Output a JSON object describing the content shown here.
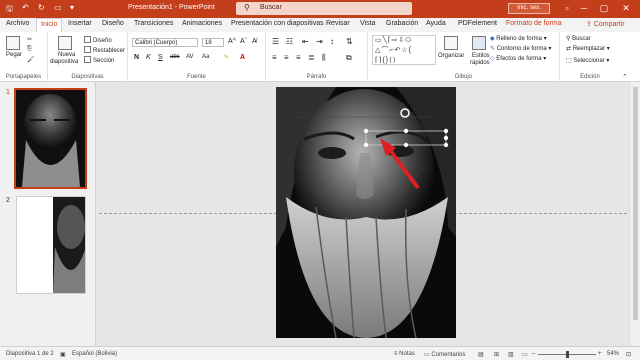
{
  "titlebar": {
    "doc_title": "Presentación1 - PowerPoint",
    "search_placeholder": "Buscar",
    "signin_label": "Inic. ses.",
    "window_buttons": [
      "─",
      "▢",
      "✕"
    ]
  },
  "tabs": [
    "Archivo",
    "Inicio",
    "Insertar",
    "Diseño",
    "Transiciones",
    "Animaciones",
    "Presentación con diapositivas",
    "Revisar",
    "Vista",
    "Grabación",
    "Ayuda",
    "PDFelement",
    "Formato de forma"
  ],
  "share_label": "Compartir",
  "ribbon": {
    "portapapeles": {
      "label": "Portapapeles",
      "paste": "Pegar"
    },
    "diapositivas": {
      "label": "Diapositivas",
      "new_slide_line1": "Nueva",
      "new_slide_line2": "diapositiva",
      "layout": "Diseño",
      "reset": "Restablecer",
      "section": "Sección"
    },
    "fuente": {
      "label": "Fuente",
      "font_name": "Calibri (Cuerpo)",
      "font_size": "18",
      "styles": [
        "N",
        "K",
        "S",
        "abc",
        "AV",
        "Aa"
      ]
    },
    "parrafo": {
      "label": "Párrafo"
    },
    "dibujo": {
      "label": "Dibujo",
      "organize": "Organizar",
      "quick_styles_line1": "Estilos",
      "quick_styles_line2": "rápidos",
      "fill": "Relleno de forma",
      "outline": "Contorno de forma",
      "effects": "Efectos de forma"
    },
    "edicion": {
      "label": "Edición",
      "find": "Buscar",
      "replace": "Reemplazar",
      "select": "Seleccionar"
    }
  },
  "slides_panel": {
    "numbers": [
      "1",
      "2"
    ]
  },
  "statusbar": {
    "slide_info": "Diapositiva 1 de 2",
    "language": "Español (Bolivia)",
    "notes": "Notas",
    "comments": "Comentarios",
    "zoom": "54%"
  },
  "colors": {
    "accent": "#c43e1c",
    "arrow": "#e02020"
  }
}
